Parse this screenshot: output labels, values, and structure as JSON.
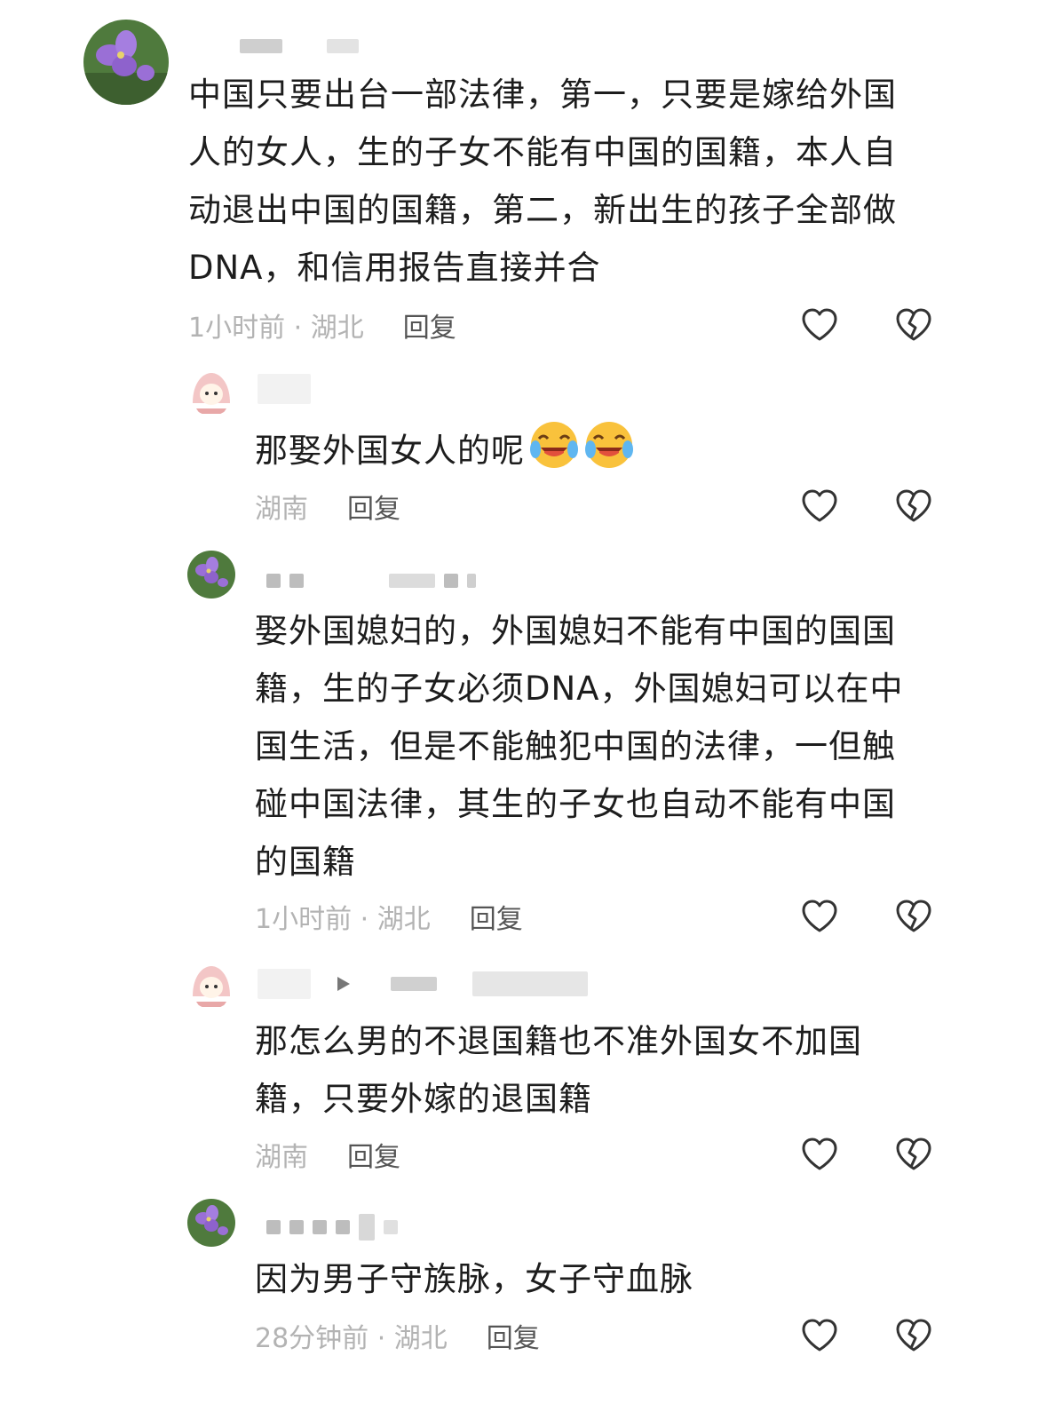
{
  "comments": [
    {
      "text": "中国只要出台一部法律，第一，只要是嫁给外国人的女人，生的子女不能有中国的国籍，本人自动退出中国的国籍，第二，新出生的孩子全部做DNA，和信用报告直接并合",
      "lines": [
        "中国只要出台一部法律，第一，只要是嫁给外国",
        "人的女人，生的子女不能有中国的国籍，本人自",
        "动退出中国的国籍，第二，新出生的孩子全部做",
        "DNA，和信用报告直接并合"
      ],
      "meta": "1小时前 · 湖北",
      "reply": "回复"
    },
    {
      "lines": [
        "那娶外国女人的呢"
      ],
      "emojis": [
        "tears-of-joy-emoji",
        "tears-of-joy-emoji"
      ],
      "meta": "湖南",
      "reply": "回复"
    },
    {
      "lines": [
        "娶外国媳妇的，外国媳妇不能有中国的国国",
        "籍，生的子女必须DNA，外国媳妇可以在中",
        "国生活，但是不能触犯中国的法律，一但触",
        "碰中国法律，其生的子女也自动不能有中国",
        "的国籍"
      ],
      "meta": "1小时前 · 湖北",
      "reply": "回复"
    },
    {
      "lines": [
        "那怎么男的不退国籍也不准外国女不加国",
        "籍，只要外嫁的退国籍"
      ],
      "meta": "湖南",
      "reply": "回复"
    },
    {
      "lines": [
        "因为男子守族脉，女子守血脉"
      ],
      "meta": "28分钟前 · 湖北",
      "reply": "回复"
    }
  ],
  "icons": {
    "like": "heart-outline-icon",
    "dislike": "broken-heart-icon"
  },
  "colors": {
    "text": "#1d1d1d",
    "meta": "#b3b3b3",
    "reply": "#555555",
    "icon": "#333333"
  }
}
